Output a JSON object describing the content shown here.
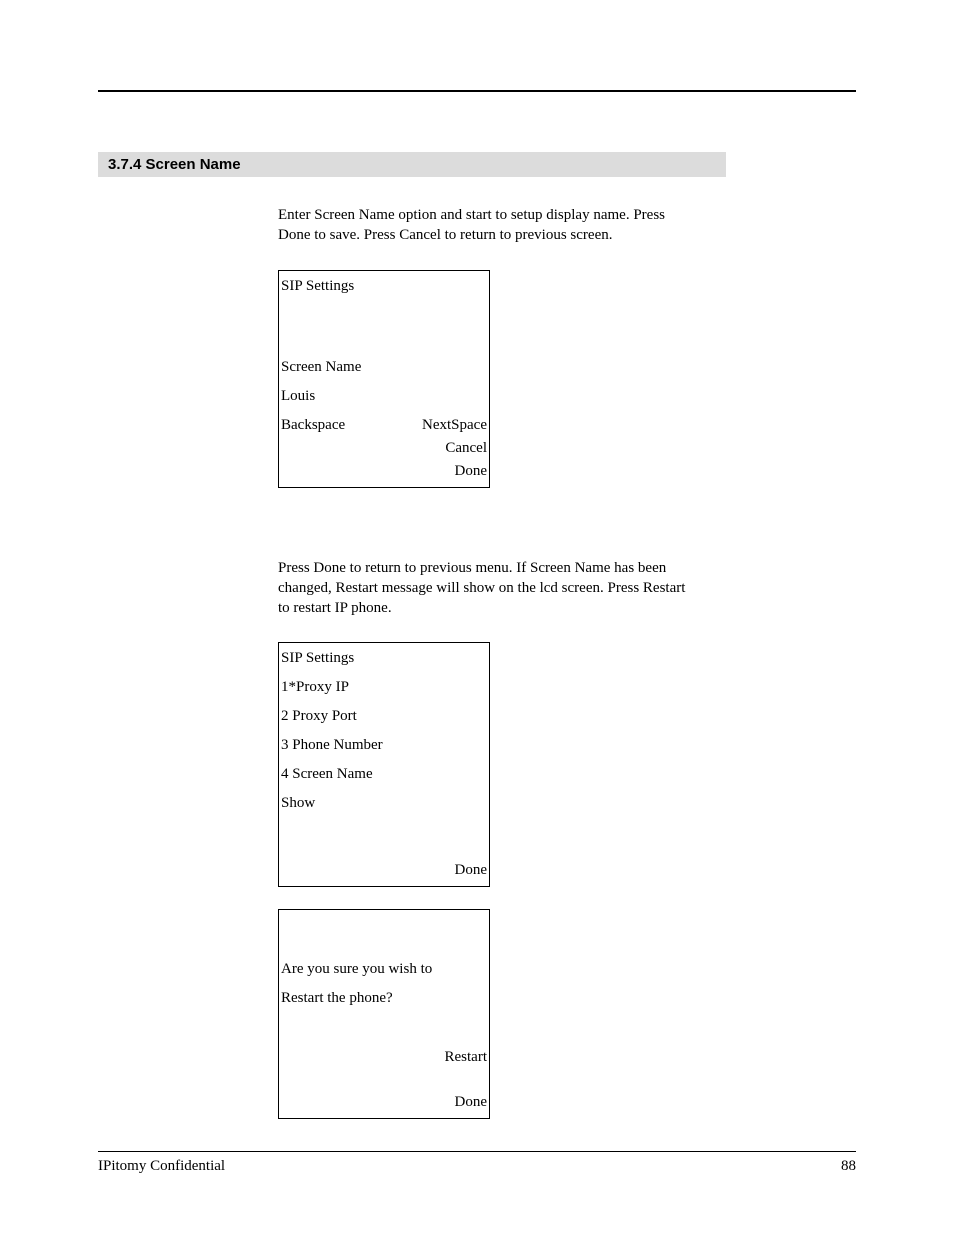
{
  "section": {
    "heading": "3.7.4 Screen Name"
  },
  "para1": "Enter Screen Name option and start to setup display name. Press Done to save. Press Cancel to return to previous screen.",
  "lcd1": {
    "title": "SIP Settings",
    "label": "Screen Name",
    "value": "Louis",
    "backspace": "Backspace",
    "nextspace": "NextSpace",
    "cancel": "Cancel",
    "done": "Done"
  },
  "para2": "Press Done to return to previous menu. If Screen Name has been changed, Restart message will show on the lcd screen. Press Restart to restart IP phone.",
  "lcd2": {
    "title": "SIP Settings",
    "item1": "1*Proxy IP",
    "item2": "2 Proxy Port",
    "item3": "3 Phone Number",
    "item4": "4 Screen Name",
    "show": "Show",
    "done": "Done"
  },
  "lcd3": {
    "line1": "Are you sure you wish to",
    "line2": "Restart the phone?",
    "restart": "Restart",
    "done": "Done"
  },
  "footer": {
    "left": "IPitomy Confidential",
    "right": "88"
  }
}
